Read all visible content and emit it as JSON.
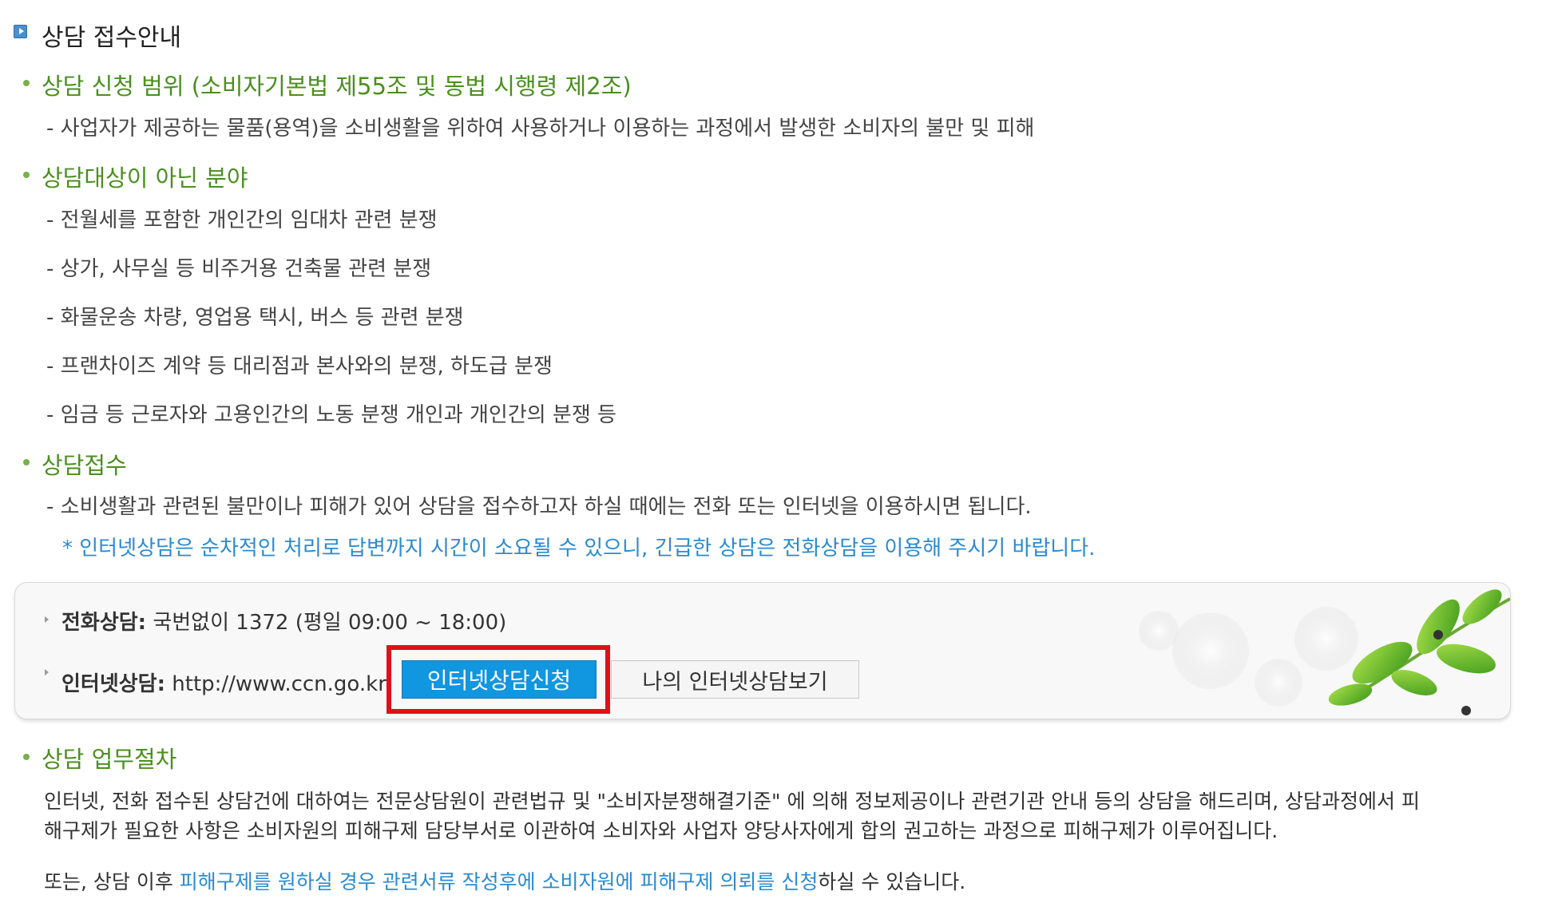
{
  "page_title": "상담 접수안내",
  "sections": {
    "scope": {
      "title": "상담 신청 범위 (소비자기본법 제55조 및 동법 시행령 제2조)",
      "items": [
        "- 사업자가 제공하는 물품(용역)을 소비생활을 위하여 사용하거나 이용하는 과정에서 발생한 소비자의 불만 및 피해"
      ]
    },
    "excluded": {
      "title": "상담대상이 아닌 분야",
      "items": [
        "- 전월세를 포함한 개인간의 임대차 관련 분쟁",
        "- 상가, 사무실 등 비주거용 건축물 관련 분쟁",
        "- 화물운송 차량, 영업용 택시, 버스 등 관련 분쟁",
        "- 프랜차이즈 계약 등 대리점과 본사와의 분쟁, 하도급 분쟁",
        "- 임금 등 근로자와 고용인간의 노동 분쟁 개인과 개인간의 분쟁 등"
      ]
    },
    "reception": {
      "title": "상담접수",
      "item": "- 소비생활과 관련된 불만이나 피해가 있어 상담을 접수하고자 하실 때에는 전화 또는 인터넷을 이용하시면 됩니다.",
      "note": "* 인터넷상담은 순차적인 처리로 답변까지 시간이 소요될 수 있으니, 긴급한 상담은 전화상담을 이용해 주시기 바랍니다."
    },
    "procedure": {
      "title": "상담 업무절차",
      "paragraph1_line1": "인터넷, 전화 접수된 상담건에 대하여는 전문상담원이 관련법규 및 \"소비자분쟁해결기준\" 에 의해 정보제공이나 관련기관 안내 등의 상담을 해드리며, 상담과정에서 피",
      "paragraph1_line2": "해구제가 필요한 사항은 소비자원의 피해구제 담당부서로 이관하여 소비자와 사업자 양당사자에게 합의 권고하는 과정으로 피해구제가 이루어집니다.",
      "paragraph2_prefix": "또는, 상담 이후 ",
      "paragraph2_link": "피해구제를 원하실 경우 관련서류 작성후에 소비자원에 피해구제 의뢰를 신청",
      "paragraph2_suffix": "하실 수 있습니다."
    }
  },
  "contact_box": {
    "phone_label": "전화상담:",
    "phone_value": " 국번없이 1372 (평일 09:00 ~ 18:00)",
    "internet_label": "인터넷상담:",
    "internet_value": " http://www.ccn.go.kr",
    "apply_button": "인터넷상담신청",
    "view_button": "나의 인터넷상담보기"
  },
  "colors": {
    "section_title": "#4b8f1f",
    "note": "#2a8bd0",
    "primary_button": "#1196e0",
    "highlight_border": "#e0101b"
  },
  "icons": {
    "title": "arrow-square-icon",
    "bullet": "green-dot-icon",
    "box_bullet": "triangle-bullet-icon",
    "decoration": "green-leaves-icon"
  }
}
